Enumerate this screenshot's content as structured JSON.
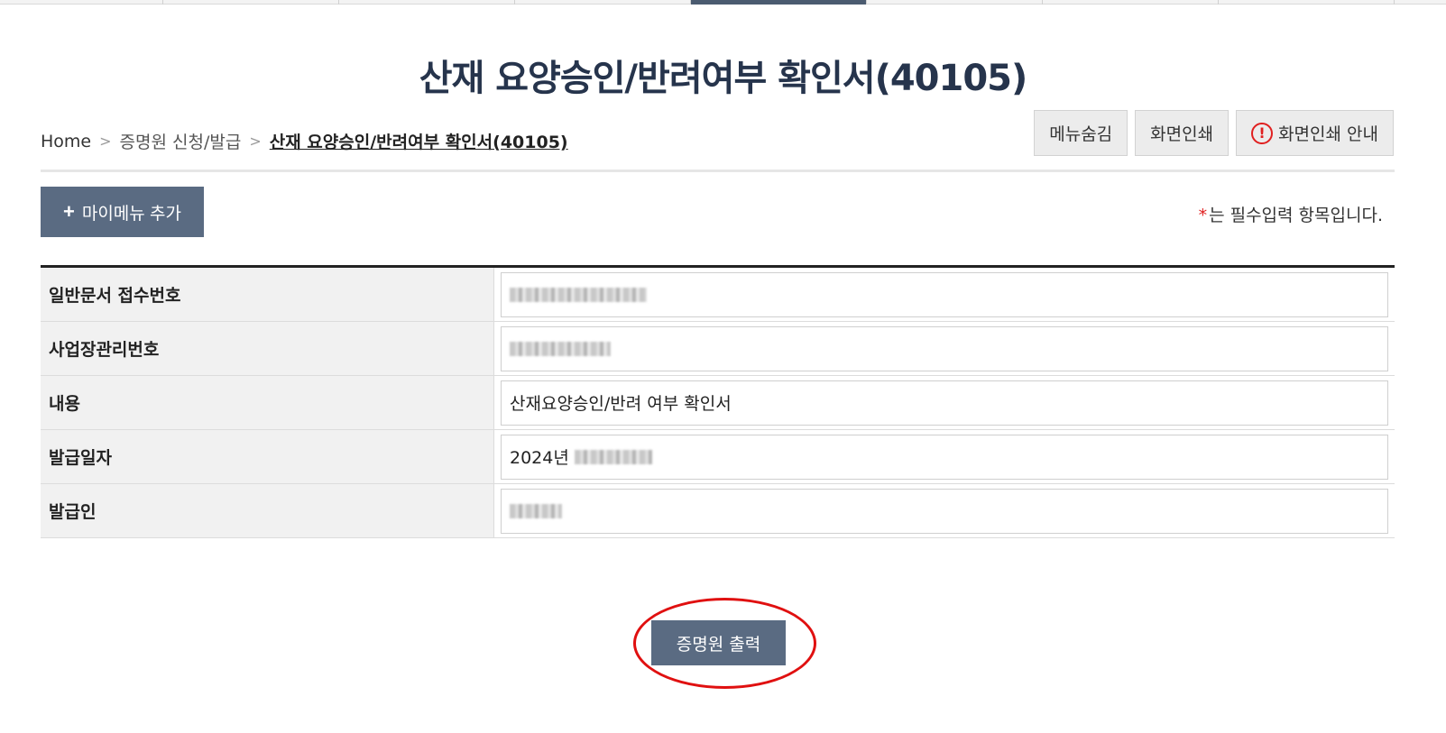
{
  "page": {
    "title": "산재 요양승인/반려여부 확인서(40105)"
  },
  "breadcrumb": {
    "home": "Home",
    "level1": "증명원 신청/발급",
    "current": "산재 요양승인/반려여부 확인서(40105)"
  },
  "util_buttons": {
    "hide_menu": "메뉴숨김",
    "print_screen": "화면인쇄",
    "print_guide": "화면인쇄 안내"
  },
  "mymenu": {
    "plus": "+",
    "label": "마이메뉴 추가"
  },
  "required_note": {
    "star": "*",
    "text": "는 필수입력 항목입니다."
  },
  "form": {
    "rows": [
      {
        "label": "일반문서 접수번호",
        "value": ""
      },
      {
        "label": "사업장관리번호",
        "value": ""
      },
      {
        "label": "내용",
        "value": "산재요양승인/반려 여부 확인서"
      },
      {
        "label": "발급일자",
        "value": "2024년"
      },
      {
        "label": "발급인",
        "value": ""
      }
    ]
  },
  "actions": {
    "print_certificate": "증명원 출력"
  },
  "icons": {
    "warning": "warning-circle-icon"
  },
  "colors": {
    "accent": "#5a6b82",
    "title": "#26344c",
    "highlight": "#e01010"
  }
}
